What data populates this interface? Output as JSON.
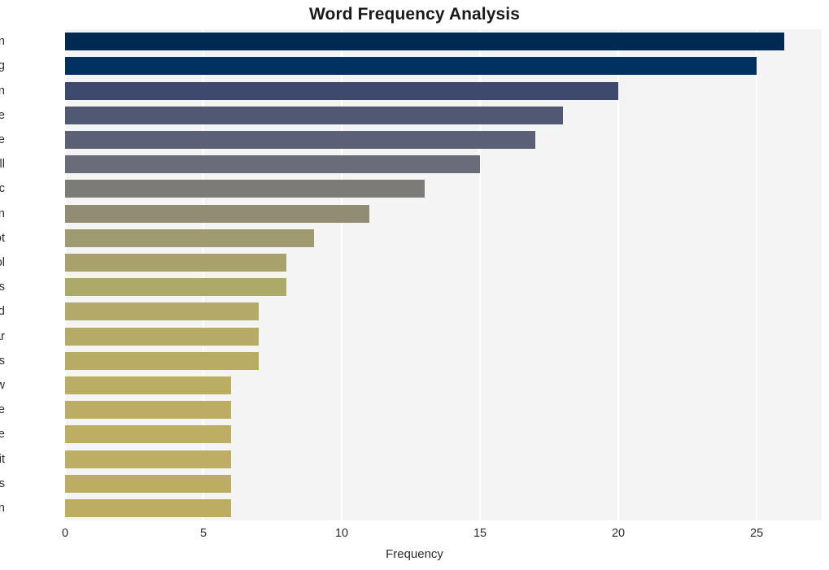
{
  "chart_data": {
    "type": "bar",
    "orientation": "horizontal",
    "title": "Word Frequency Analysis",
    "xlabel": "Frequency",
    "ylabel": "",
    "categories": [
      "men",
      "young",
      "gun",
      "people",
      "violence",
      "kill",
      "public",
      "peterson",
      "shoot",
      "school",
      "mass",
      "old",
      "year",
      "experts",
      "new",
      "time",
      "include",
      "commit",
      "shooters",
      "isolation"
    ],
    "values": [
      26,
      25,
      20,
      18,
      17,
      15,
      13,
      11,
      9,
      8,
      8,
      7,
      7,
      7,
      6,
      6,
      6,
      6,
      6,
      6
    ],
    "bar_colors": [
      "#002a51",
      "#003161",
      "#3d4a6d",
      "#515873",
      "#5b6077",
      "#6a6c7a",
      "#7c7b78",
      "#918d74",
      "#a09a6f",
      "#a9a16c",
      "#adaa69",
      "#b4a968",
      "#b6ab66",
      "#b8ac65",
      "#baad64",
      "#bbad64",
      "#bcae63",
      "#bcae63",
      "#bcad63",
      "#bcad63"
    ],
    "xlim": [
      0,
      27.35
    ],
    "xticks": [
      0,
      5,
      10,
      15,
      20,
      25
    ],
    "xtick_labels": [
      "0",
      "5",
      "10",
      "15",
      "20",
      "25"
    ],
    "grid": "vertical",
    "legend": null,
    "style": "whitegrid",
    "plot_background": "#f4f4f5",
    "gridline_color": "#ffffff",
    "figure_background": "#ffffff"
  }
}
